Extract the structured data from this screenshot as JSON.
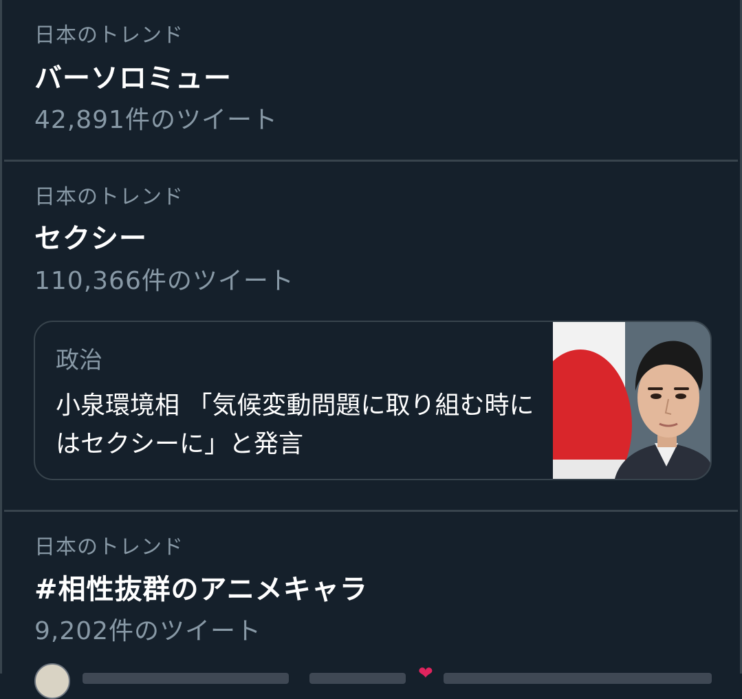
{
  "trends": [
    {
      "context": "日本のトレンド",
      "title": "バーソロミュー",
      "count": "42,891件のツイート"
    },
    {
      "context": "日本のトレンド",
      "title": "セクシー",
      "count": "110,366件のツイート",
      "news": {
        "category": "政治",
        "headline": "小泉環境相 「気候変動問題に取り組む時にはセクシーに」と発言",
        "thumbnail": "portrait-photo"
      }
    },
    {
      "context": "日本のトレンド",
      "title": "#相性抜群のアニメキャラ",
      "count": "9,202件のツイート"
    }
  ],
  "colors": {
    "background": "#15202b",
    "border": "#38444d",
    "secondary_text": "#8899a6",
    "primary_text": "#ffffff",
    "heart": "#e0245e"
  },
  "icons": [
    "heart-icon"
  ]
}
